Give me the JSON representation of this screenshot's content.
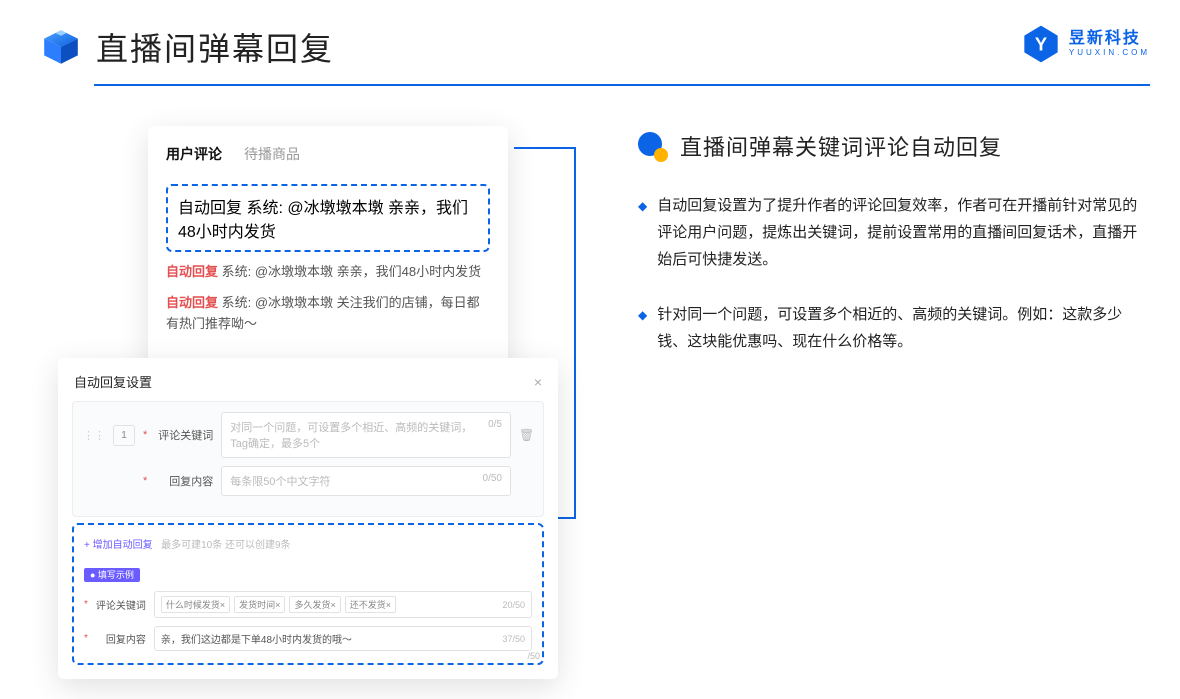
{
  "header": {
    "title": "直播间弹幕回复"
  },
  "brand": {
    "cn": "昱新科技",
    "en": "YUUXIN.COM"
  },
  "section": {
    "title": "直播间弹幕关键词评论自动回复"
  },
  "bullets": [
    "自动回复设置为了提升作者的评论回复效率，作者可在开播前针对常见的评论用户问题，提炼出关键词，提前设置常用的直播间回复话术，直播开始后可快捷发送。",
    "针对同一个问题，可设置多个相近的、高频的关键词。例如：这款多少钱、这块能优惠吗、现在什么价格等。"
  ],
  "panel1": {
    "tab1": "用户评论",
    "tab2": "待播商品",
    "m1_tag": "自动回复",
    "m1_body": "系统: @冰墩墩本墩 亲亲，我们48小时内发货",
    "m2_tag": "自动回复",
    "m2_body": "系统: @冰墩墩本墩 亲亲，我们48小时内发货",
    "m3_tag": "自动回复",
    "m3_body": "系统: @冰墩墩本墩 关注我们的店铺，每日都有热门推荐呦～"
  },
  "panel2": {
    "title": "自动回复设置",
    "order": "1",
    "r1_lbl": "评论关键词",
    "r1_ph": "对同一个问题，可设置多个相近、高频的关键词，Tag确定，最多5个",
    "r1_cnt": "0/5",
    "r2_lbl": "回复内容",
    "r2_ph": "每条限50个中文字符",
    "r2_cnt": "0/50",
    "add": "+ 增加自动回复",
    "add_note": "最多可建10条 还可以创建9条",
    "badge": "● 填写示例",
    "ex1_lbl": "评论关键词",
    "chips": [
      "什么时候发货×",
      "发货时间×",
      "多久发货×",
      "还不发货×"
    ],
    "ex1_cnt": "20/50",
    "ex2_lbl": "回复内容",
    "ex2_val": "亲，我们这边都是下单48小时内发货的哦～",
    "ex2_cnt": "37/50",
    "outer_cnt": "/50"
  }
}
